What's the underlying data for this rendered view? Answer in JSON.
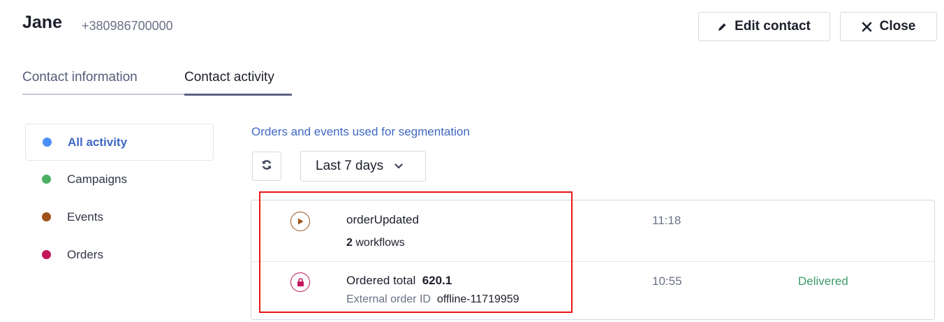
{
  "contact": {
    "name": "Jane",
    "phone": "+380986700000"
  },
  "header": {
    "edit_label": "Edit contact",
    "close_label": "Close"
  },
  "tabs": [
    {
      "label": "Contact information",
      "active": false
    },
    {
      "label": "Contact activity",
      "active": true
    }
  ],
  "sidebar": {
    "items": [
      {
        "label": "All activity",
        "color": "#4a8ff5",
        "active": true
      },
      {
        "label": "Campaigns",
        "color": "#4caf64",
        "active": false
      },
      {
        "label": "Events",
        "color": "#a0521a",
        "active": false
      },
      {
        "label": "Orders",
        "color": "#c2175b",
        "active": false
      }
    ]
  },
  "filters": {
    "segmentation_link": "Orders and events used for segmentation",
    "period": "Last 7 days"
  },
  "activity": [
    {
      "type": "event",
      "icon": "play-circle-icon",
      "title": "orderUpdated",
      "count": "2",
      "count_label": "workflows",
      "time": "11:18",
      "status": ""
    },
    {
      "type": "order",
      "icon": "shopping-bag-icon",
      "title_label": "Ordered total",
      "total": "620.1",
      "ext_label": "External order ID",
      "ext_value": "offline-11719959",
      "time": "10:55",
      "status": "Delivered"
    }
  ],
  "colors": {
    "accent": "#3f68c2",
    "event": "#a0521a",
    "order": "#c2175b",
    "delivered": "#3d9a6a",
    "highlight": "#e81616"
  }
}
